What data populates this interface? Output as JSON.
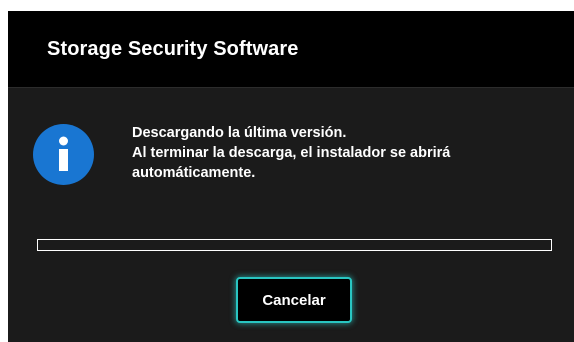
{
  "window": {
    "title": "Storage Security Software"
  },
  "message": {
    "icon": "info-icon",
    "lines": [
      "Descargando la última versión.",
      "Al terminar la descarga, el instalador se abrirá",
      "automáticamente."
    ]
  },
  "progress": {
    "value": 0
  },
  "buttons": {
    "cancel_label": "Cancelar"
  },
  "colors": {
    "icon_blue": "#1976d2",
    "button_border": "#29c6c2",
    "dialog_bg": "#1b1b1b",
    "titlebar_bg": "#000000"
  }
}
